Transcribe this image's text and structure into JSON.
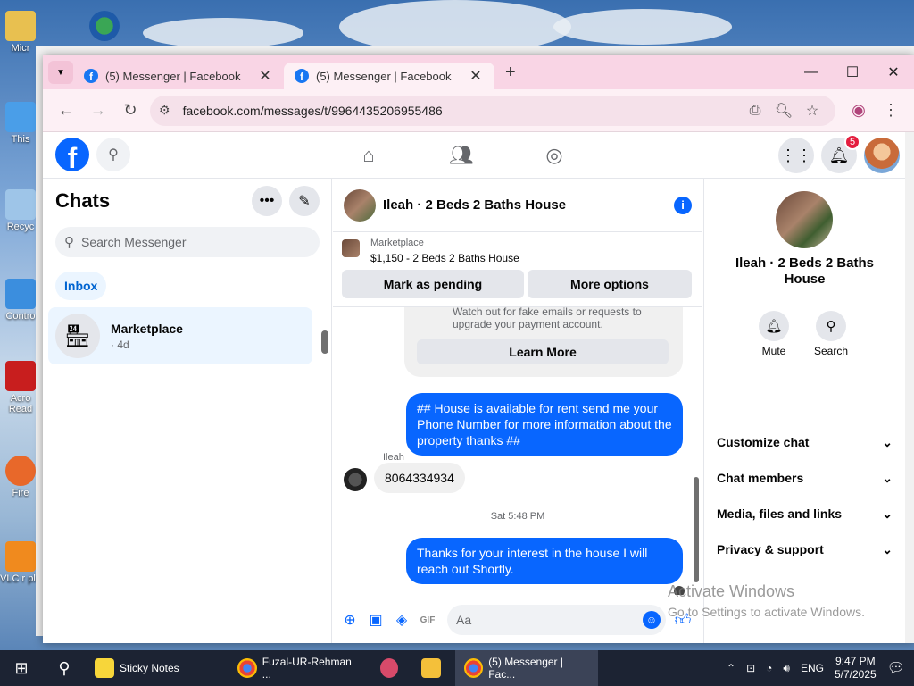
{
  "desktop": {
    "icons": [
      {
        "label": "Micr"
      },
      {
        "label": "This"
      },
      {
        "label": "Recyc"
      },
      {
        "label": "Contro"
      },
      {
        "label": "Acro Read"
      },
      {
        "label": "Fire"
      },
      {
        "label": "VLC r pla"
      }
    ]
  },
  "browser": {
    "tabs": [
      {
        "title": "(5) Messenger | Facebook"
      },
      {
        "title": "(5) Messenger | Facebook"
      }
    ],
    "url": "facebook.com/messages/t/9964435206955486"
  },
  "fb": {
    "notifications": "5"
  },
  "chats": {
    "title": "Chats",
    "search_placeholder": "Search Messenger",
    "filter": "Inbox",
    "items": [
      {
        "name": "Marketplace",
        "time": "· 4d"
      }
    ]
  },
  "conversation": {
    "title": "Ileah · 2 Beds 2 Baths House",
    "marketplace_label": "Marketplace",
    "listing": "$1,150 - 2 Beds 2 Baths House",
    "mark_pending": "Mark as pending",
    "more_options": "More options",
    "old_text": "Watch out for fake emails or requests to upgrade your payment account.",
    "learn_more": "Learn More",
    "msg1": "## House is available for rent send me your Phone Number for more information about the property thanks ##",
    "sender": "Ileah",
    "msg2": "8064334934",
    "timestamp": "Sat 5:48 PM",
    "msg3": "Thanks for your interest in the house I will reach out Shortly.",
    "composer_placeholder": "Aa"
  },
  "details": {
    "name": "Ileah · 2 Beds 2 Baths House",
    "mute": "Mute",
    "search": "Search",
    "sections": [
      "Customize chat",
      "Chat members",
      "Media, files and links",
      "Privacy & support"
    ]
  },
  "watermark": {
    "line1": "Activate Windows",
    "line2": "Go to Settings to activate Windows."
  },
  "taskbar": {
    "items": [
      "Sticky Notes",
      "Fuzal-UR-Rehman ...",
      "",
      "",
      "(5) Messenger | Fac..."
    ],
    "lang": "ENG",
    "time": "9:47 PM",
    "date": "5/7/2025"
  },
  "colors": {
    "accent": "#0866ff",
    "tabbar": "#f9d5e5",
    "taskbar": "#1c2333"
  }
}
